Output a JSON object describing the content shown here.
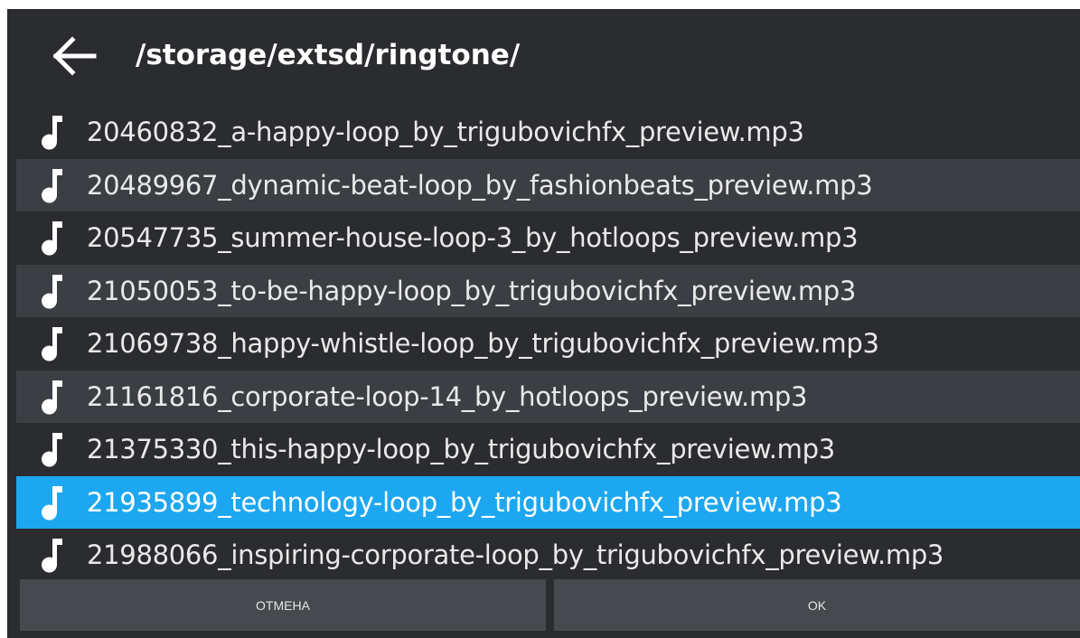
{
  "header": {
    "back_icon": "arrow-left-icon",
    "path": "/storage/extsd/ringtone/"
  },
  "files": {
    "icon": "music-note-icon",
    "selected_index": 7,
    "items": [
      {
        "name": "20460832_a-happy-loop_by_trigubovichfx_preview.mp3"
      },
      {
        "name": "20489967_dynamic-beat-loop_by_fashionbeats_preview.mp3"
      },
      {
        "name": "20547735_summer-house-loop-3_by_hotloops_preview.mp3"
      },
      {
        "name": "21050053_to-be-happy-loop_by_trigubovichfx_preview.mp3"
      },
      {
        "name": "21069738_happy-whistle-loop_by_trigubovichfx_preview.mp3"
      },
      {
        "name": "21161816_corporate-loop-14_by_hotloops_preview.mp3"
      },
      {
        "name": "21375330_this-happy-loop_by_trigubovichfx_preview.mp3"
      },
      {
        "name": "21935899_technology-loop_by_trigubovichfx_preview.mp3"
      },
      {
        "name": "21988066_inspiring-corporate-loop_by_trigubovichfx_preview.mp3"
      }
    ]
  },
  "buttons": {
    "cancel_label": "ОТМЕНА",
    "ok_label": "OK"
  },
  "colors": {
    "background": "#2a2c2f",
    "row_alt": "#3b3e42",
    "selected": "#1da7f0",
    "button": "#46494d"
  }
}
